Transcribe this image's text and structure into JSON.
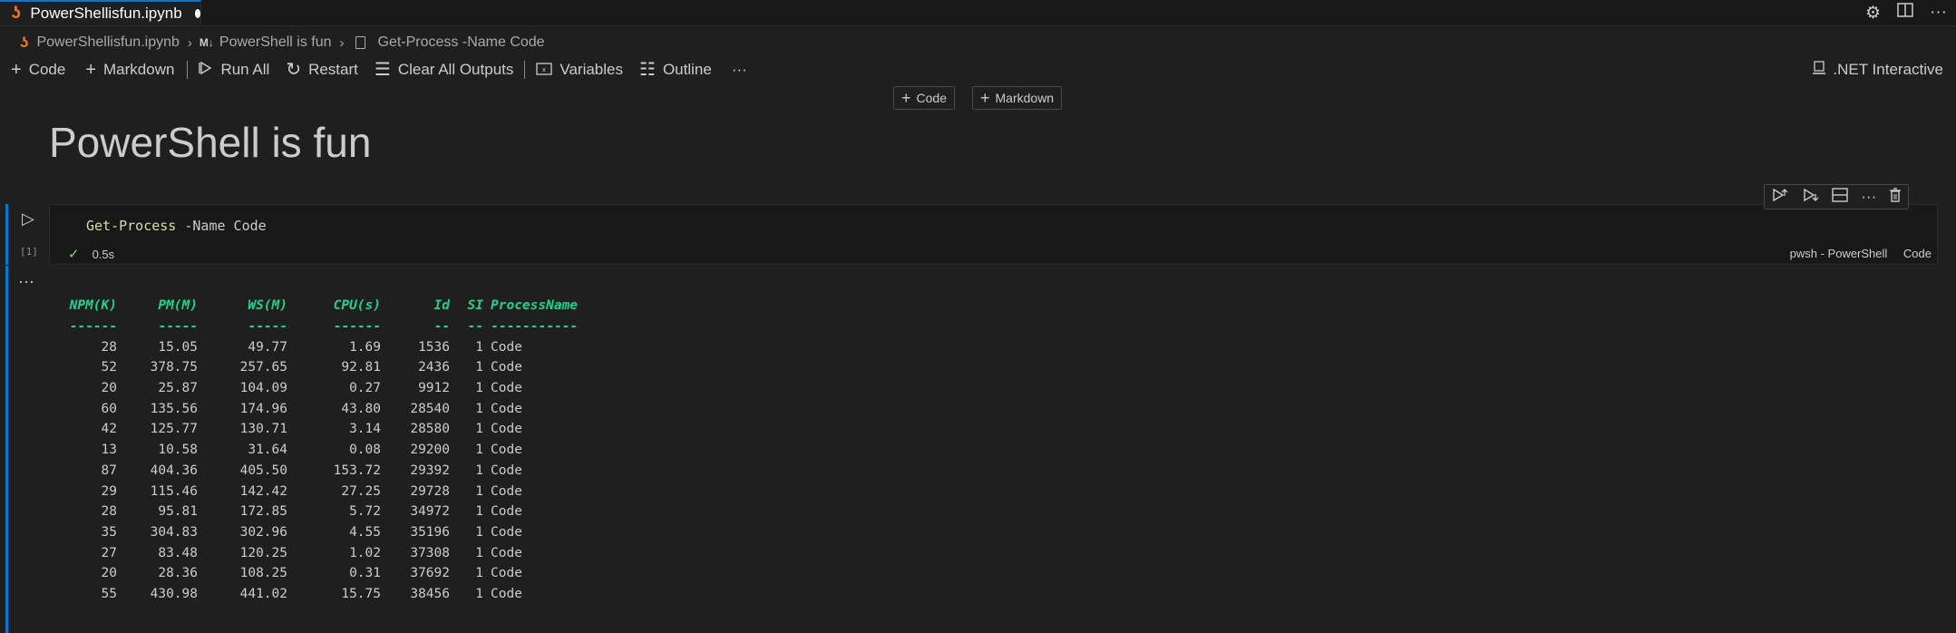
{
  "tab": {
    "filename": "PowerShellisfun.ipynb"
  },
  "breadcrumb": {
    "file": "PowerShellisfun.ipynb",
    "md_badge": "M↓",
    "section": "PowerShell is fun",
    "cell": "Get-Process -Name Code"
  },
  "toolbar": {
    "code": "Code",
    "markdown": "Markdown",
    "run_all": "Run All",
    "restart": "Restart",
    "clear_outputs": "Clear All Outputs",
    "variables": "Variables",
    "outline": "Outline",
    "more": "···",
    "kernel": ".NET Interactive"
  },
  "insert": {
    "code": "Code",
    "markdown": "Markdown"
  },
  "markdown_cell": {
    "heading": "PowerShell is fun"
  },
  "code_cell": {
    "exec_count": "[1]",
    "code_cmd": "Get-Process",
    "code_param": "-Name Code",
    "duration": "0.5s",
    "language": "pwsh - PowerShell",
    "cell_kind": "Code"
  },
  "output": {
    "headers": [
      "NPM(K)",
      "PM(M)",
      "WS(M)",
      "CPU(s)",
      "Id",
      "SI",
      "ProcessName"
    ],
    "underlines": [
      "------",
      "-----",
      "-----",
      "------",
      "--",
      "--",
      "-----------"
    ],
    "rows": [
      [
        "28",
        "15.05",
        "49.77",
        "1.69",
        "1536",
        "1",
        "Code"
      ],
      [
        "52",
        "378.75",
        "257.65",
        "92.81",
        "2436",
        "1",
        "Code"
      ],
      [
        "20",
        "25.87",
        "104.09",
        "0.27",
        "9912",
        "1",
        "Code"
      ],
      [
        "60",
        "135.56",
        "174.96",
        "43.80",
        "28540",
        "1",
        "Code"
      ],
      [
        "42",
        "125.77",
        "130.71",
        "3.14",
        "28580",
        "1",
        "Code"
      ],
      [
        "13",
        "10.58",
        "31.64",
        "0.08",
        "29200",
        "1",
        "Code"
      ],
      [
        "87",
        "404.36",
        "405.50",
        "153.72",
        "29392",
        "1",
        "Code"
      ],
      [
        "29",
        "115.46",
        "142.42",
        "27.25",
        "29728",
        "1",
        "Code"
      ],
      [
        "28",
        "95.81",
        "172.85",
        "5.72",
        "34972",
        "1",
        "Code"
      ],
      [
        "35",
        "304.83",
        "302.96",
        "4.55",
        "35196",
        "1",
        "Code"
      ],
      [
        "27",
        "83.48",
        "120.25",
        "1.02",
        "37308",
        "1",
        "Code"
      ],
      [
        "20",
        "28.36",
        "108.25",
        "0.31",
        "37692",
        "1",
        "Code"
      ],
      [
        "55",
        "430.98",
        "441.02",
        "15.75",
        "38456",
        "1",
        "Code"
      ]
    ]
  },
  "colors": {
    "accent": "#0078d4",
    "jupyter": "#f37626",
    "success": "#89d185",
    "header": "#23d18b"
  }
}
